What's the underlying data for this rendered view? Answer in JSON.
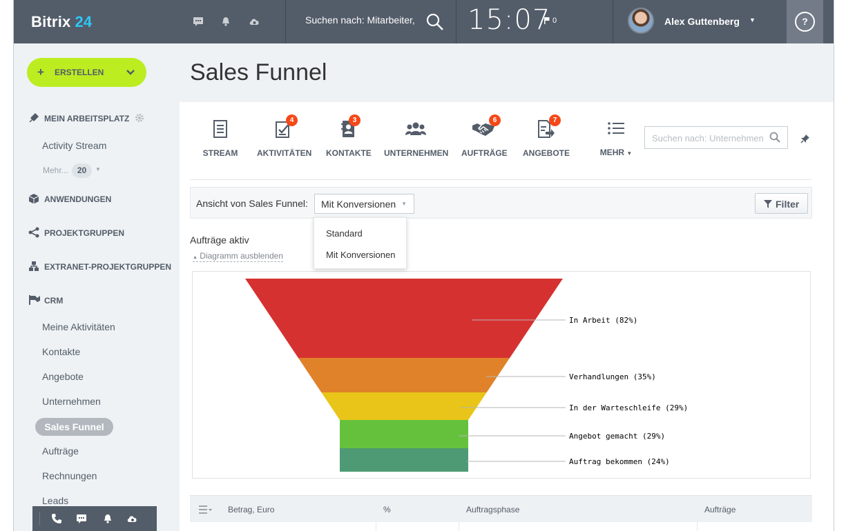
{
  "header": {
    "logo_name": "Bitrix",
    "logo_num": "24",
    "search_text": "Suchen nach: Mitarbeiter,",
    "clock": "15:07",
    "flag_count": "0",
    "user_name": "Alex Guttenberg",
    "help": "?"
  },
  "sidebar": {
    "create_label": "ERSTELLEN",
    "sections": {
      "workplace": "MEIN ARBEITSPLATZ",
      "apps": "ANWENDUNGEN",
      "projects": "PROJEKTGRUPPEN",
      "extranet": "EXTRANET-PROJEKTGRUPPEN",
      "crm": "CRM"
    },
    "activity_stream": "Activity Stream",
    "more_label": "Mehr...",
    "more_count": "20",
    "crm_items": [
      "Meine Aktivitäten",
      "Kontakte",
      "Angebote",
      "Unternehmen",
      "Sales Funnel",
      "Aufträge",
      "Rechnungen",
      "Leads"
    ],
    "active_item": "Sales Funnel"
  },
  "page_title": "Sales Funnel",
  "tabs": [
    {
      "label": "STREAM",
      "icon": "stream-icon"
    },
    {
      "label": "AKTIVITÄTEN",
      "badge": "4",
      "icon": "activities-icon"
    },
    {
      "label": "KONTAKTE",
      "badge": "3",
      "icon": "contacts-icon"
    },
    {
      "label": "UNTERNEHMEN",
      "icon": "companies-icon"
    },
    {
      "label": "AUFTRÄGE",
      "badge": "6",
      "icon": "handshake-icon"
    },
    {
      "label": "ANGEBOTE",
      "badge": "7",
      "icon": "quotes-icon"
    },
    {
      "label": "MEHR",
      "icon": "list-icon"
    }
  ],
  "crm_search_placeholder": "Suchen nach: Unternehmen",
  "view": {
    "label": "Ansicht von Sales Funnel:",
    "selected": "Mit Konversionen",
    "options": [
      "Standard",
      "Mit Konversionen"
    ]
  },
  "filter_label": "Filter",
  "chart_title": "Aufträge aktiv",
  "hide_chart": "Diagramm ausblenden",
  "chart_data": {
    "type": "funnel",
    "stages": [
      {
        "label": "In Arbeit (82%)",
        "value": 82,
        "color": "#d63131"
      },
      {
        "label": "Verhandlungen (35%)",
        "value": 35,
        "color": "#e0822a"
      },
      {
        "label": "In der Warteschleife (29%)",
        "value": 29,
        "color": "#e8c518"
      },
      {
        "label": "Angebot gemacht (29%)",
        "value": 29,
        "color": "#65c13c"
      },
      {
        "label": "Auftrag bekommen (24%)",
        "value": 24,
        "color": "#4d9a74"
      }
    ]
  },
  "table": {
    "columns": [
      "Betrag, Euro",
      "%",
      "Auftragsphase",
      "Aufträge"
    ]
  },
  "colors": {
    "header_bg": "#535c69",
    "accent_blue": "#2fc6f6",
    "create_green": "#bbed21",
    "badge_red": "#f54819"
  }
}
